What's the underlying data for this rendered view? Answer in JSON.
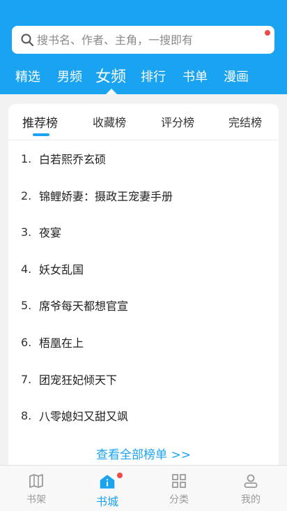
{
  "search": {
    "placeholder": "搜书名、作者、主角，一搜即有"
  },
  "top_tabs": [
    {
      "label": "精选"
    },
    {
      "label": "男频"
    },
    {
      "label": "女频",
      "active": true
    },
    {
      "label": "排行"
    },
    {
      "label": "书单"
    },
    {
      "label": "漫画"
    }
  ],
  "rank_tabs": [
    {
      "label": "推荐榜",
      "active": true
    },
    {
      "label": "收藏榜"
    },
    {
      "label": "评分榜"
    },
    {
      "label": "完结榜"
    }
  ],
  "ranking": [
    {
      "rank": "1.",
      "title": "白若熙乔玄硕"
    },
    {
      "rank": "2.",
      "title": "锦鲤娇妻：摄政王宠妻手册"
    },
    {
      "rank": "3.",
      "title": "夜宴"
    },
    {
      "rank": "4.",
      "title": "妖女乱国"
    },
    {
      "rank": "5.",
      "title": "席爷每天都想官宣"
    },
    {
      "rank": "6.",
      "title": "梧凰在上"
    },
    {
      "rank": "7.",
      "title": "团宠狂妃倾天下"
    },
    {
      "rank": "8.",
      "title": "八零媳妇又甜又飒"
    }
  ],
  "view_all": "查看全部榜单 >>",
  "bottom_nav": [
    {
      "label": "书架",
      "icon": "bookshelf-icon"
    },
    {
      "label": "书城",
      "icon": "store-home-icon",
      "active": true
    },
    {
      "label": "分类",
      "icon": "category-grid-icon"
    },
    {
      "label": "我的",
      "icon": "person-icon"
    }
  ],
  "colors": {
    "accent": "#1aa3f0",
    "badge": "#ef4b4b",
    "inactive_icon": "#9a9a9a"
  }
}
